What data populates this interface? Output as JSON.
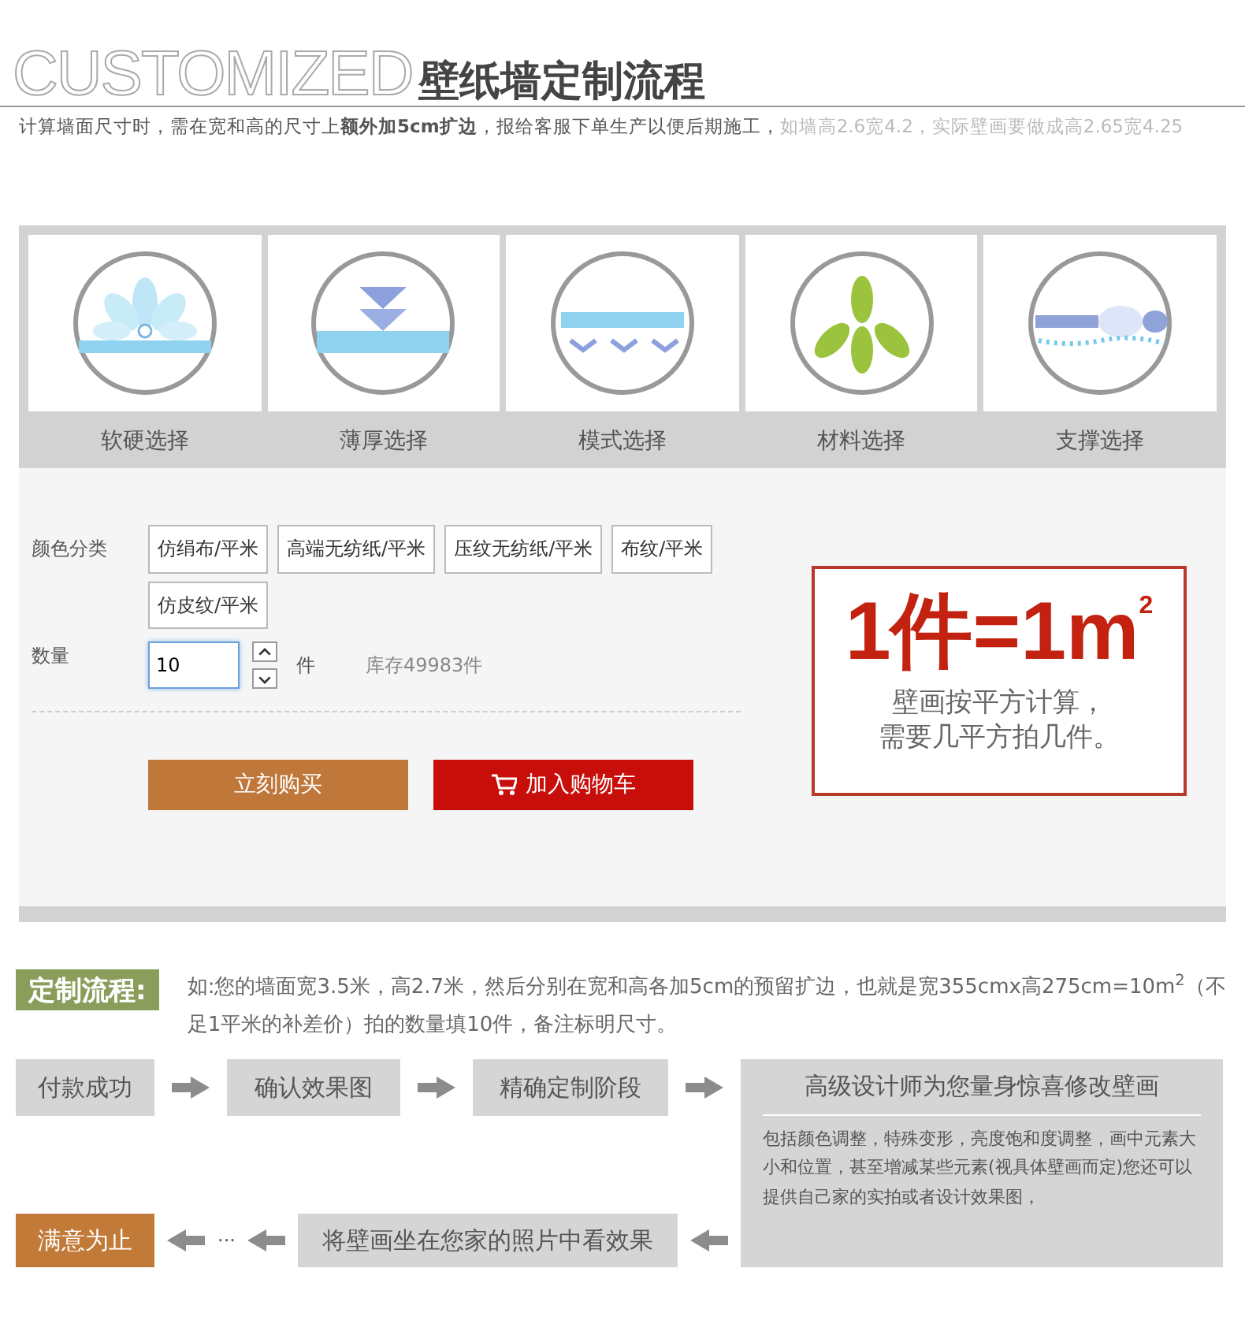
{
  "header": {
    "title_en": "CUSTOMIZED",
    "title_cn": "壁纸墙定制流程"
  },
  "notice": {
    "text": "计算墙面尺寸时，需在宽和高的尺寸上**额外加5cm扩边**，报给客服下单生产以便后期施工，",
    "example": "如墙高2.6宽4.2，实际壁画要做成高2.65宽4.25"
  },
  "features": [
    {
      "kind": "flower",
      "label": "软硬选择"
    },
    {
      "kind": "arrows",
      "label": "薄厚选择"
    },
    {
      "kind": "pattern",
      "label": "模式选择"
    },
    {
      "kind": "leaves",
      "label": "材料选择"
    },
    {
      "kind": "support",
      "label": "支撑选择"
    }
  ],
  "product": {
    "options_label": "颜色分类",
    "options": [
      {
        "label": "仿绢布/平米",
        "selected": false
      },
      {
        "label": "高端无纺纸/平米",
        "selected": false
      },
      {
        "label": "压纹无纺纸/平米",
        "selected": false
      },
      {
        "label": "布纹/平米",
        "selected": false
      },
      {
        "label": "仿皮纹/平米",
        "selected": false
      }
    ],
    "quantity_label": "数量",
    "quantity": "10",
    "unit": "件",
    "stock": "库存49983件",
    "buttons": [
      {
        "kind": "buy",
        "label": "立刻购买"
      },
      {
        "kind": "cart",
        "label": "加入购物车"
      }
    ],
    "promo": {
      "headline": "1件=1m$^{2}$",
      "lines": [
        "壁画按平方计算，",
        "需要几平方拍几件。"
      ]
    }
  },
  "process": {
    "label": "定制流程:",
    "description": "如:您的墙面宽3.5米，高2.7米，然后分别在宽和高各加5cm的预留扩边，也就是宽355cmx高275cm=10m$^{2}$（不足1平米的补差价）拍的数量填10件，备注标明尺寸。"
  },
  "steps": [
    {
      "kind": "plain",
      "title": "付款成功"
    },
    {
      "kind": "plain",
      "title": "确认效果图"
    },
    {
      "kind": "plain",
      "title": "精确定制阶段"
    },
    {
      "kind": "detail",
      "title": "高级设计师为您量身惊喜修改壁画",
      "description": "包括颜色调整，特殊变形，亮度饱和度调整，画中元素大小和位置，甚至增减某些元素(视具体壁画而定)您还可以提供自己家的实拍或者设计效果图，"
    },
    {
      "kind": "final",
      "title": "满意为止"
    },
    {
      "kind": "plain",
      "title": "将壁画坐在您家的照片中看效果"
    }
  ],
  "ellipsis": "···"
}
